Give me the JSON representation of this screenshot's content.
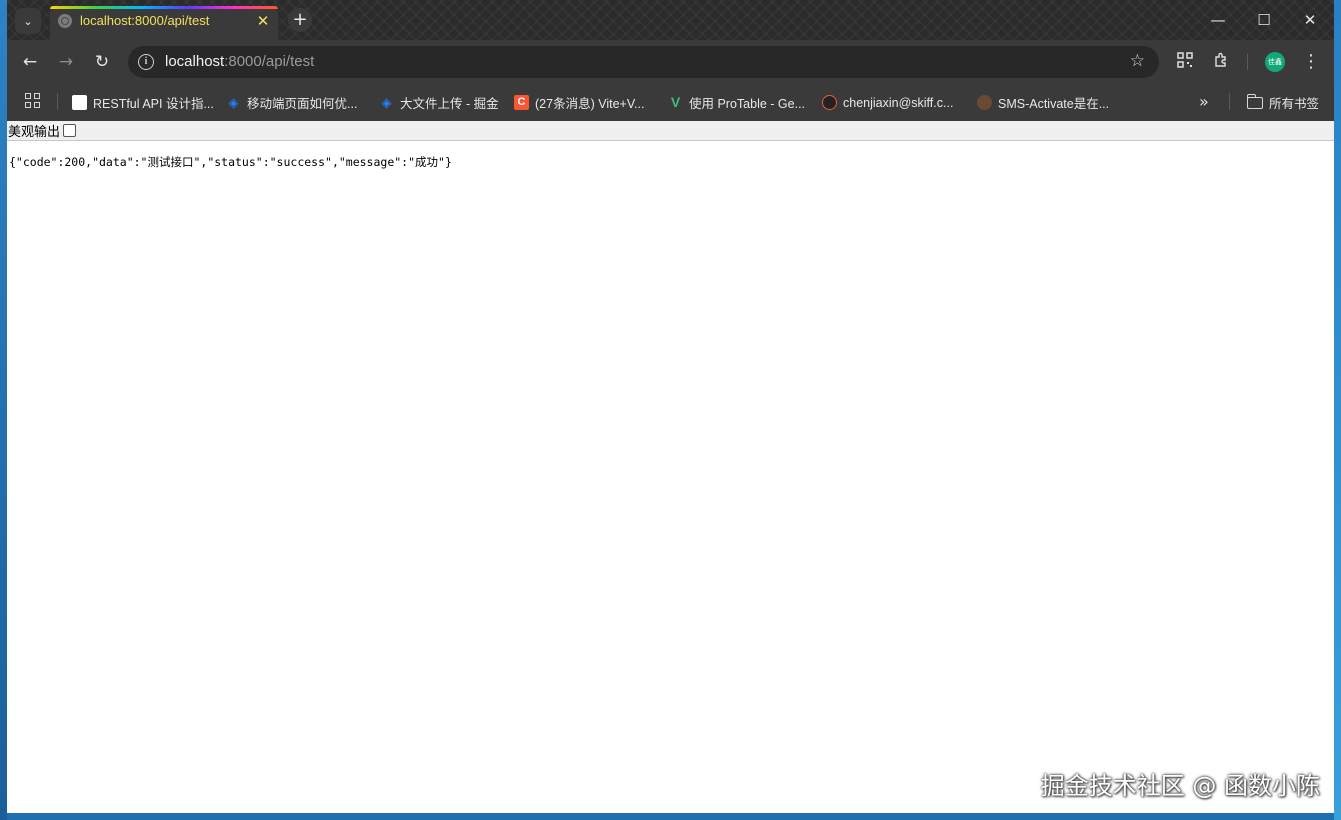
{
  "tab": {
    "title": "localhost:8000/api/test",
    "close_glyph": "✕"
  },
  "new_tab_glyph": "+",
  "tab_search_glyph": "⌄",
  "window_controls": {
    "minimize": "—",
    "maximize": "☐",
    "close": "✕"
  },
  "toolbar": {
    "back_glyph": "←",
    "forward_glyph": "→",
    "reload_glyph": "↻",
    "url_host": "localhost",
    "url_rest": ":8000/api/test",
    "info_glyph": "i",
    "star_glyph": "☆",
    "avatar_text": "佳鑫"
  },
  "bookmarks": {
    "items": [
      {
        "label": "RESTful API 设计指...",
        "icon": "restful-favicon",
        "color": "#ffffff"
      },
      {
        "label": "移动端页面如何优...",
        "icon": "juejin-favicon",
        "color": "#1e80ff"
      },
      {
        "label": "大文件上传 - 掘金",
        "icon": "juejin-favicon",
        "color": "#1e80ff"
      },
      {
        "label": "(27条消息) Vite+V...",
        "icon": "csdn-favicon",
        "color": "#fc5531"
      },
      {
        "label": "使用 ProTable - Ge...",
        "icon": "vue-favicon",
        "color": "#41b883"
      },
      {
        "label": "chenjiaxin@skiff.c...",
        "icon": "skiff-favicon",
        "color": "#ef5a3c"
      },
      {
        "label": "SMS-Activate是在...",
        "icon": "sms-favicon",
        "color": "#6b4a35"
      }
    ],
    "more_glyph": "»",
    "all_bookmarks_label": "所有书签"
  },
  "page": {
    "pretty_label": "美观输出",
    "json_output": "{\"code\":200,\"data\":\"测试接口\",\"status\":\"success\",\"message\":\"成功\"}"
  },
  "watermark": "掘金技术社区 @ 函数小陈"
}
